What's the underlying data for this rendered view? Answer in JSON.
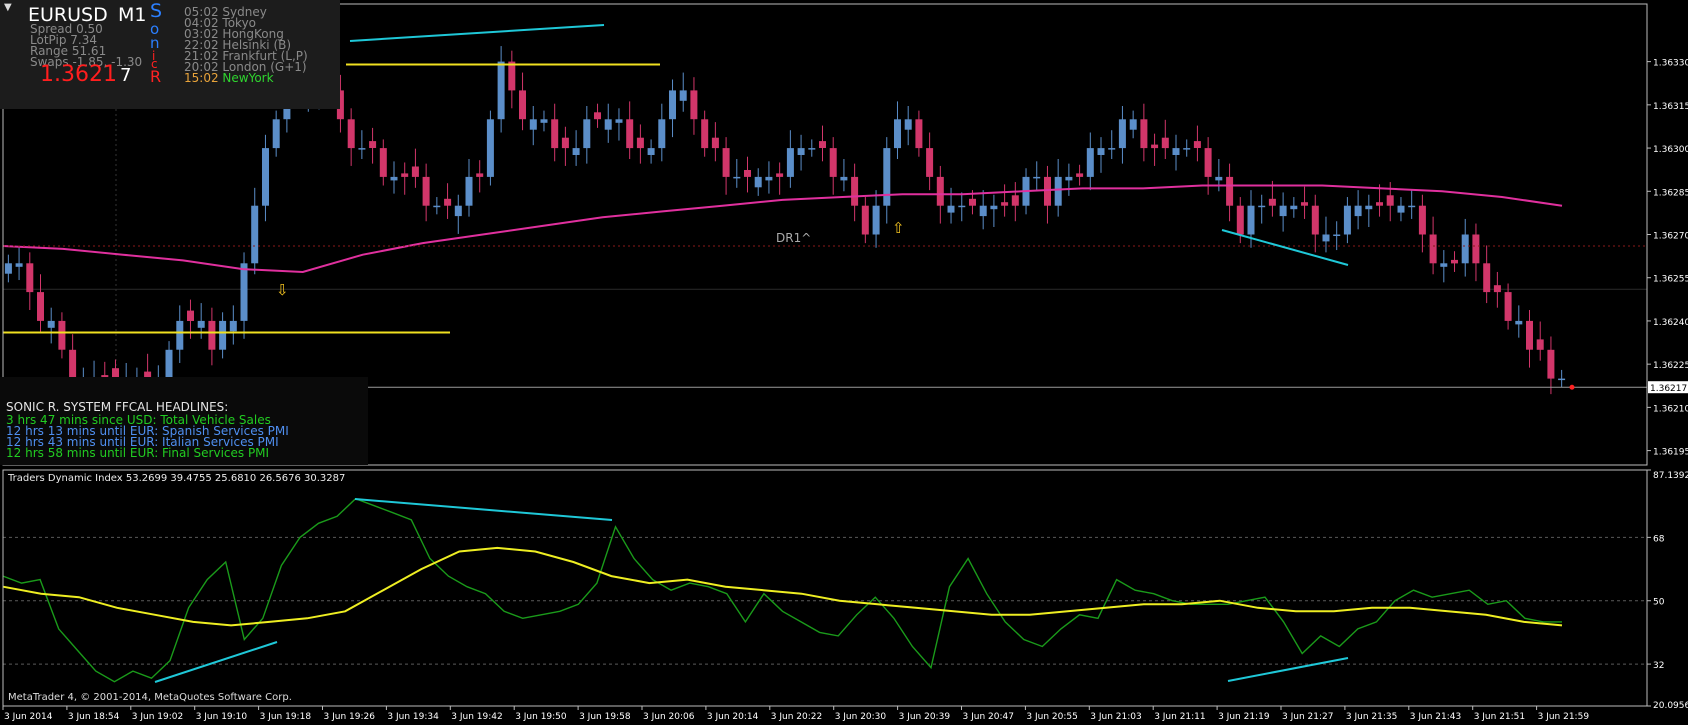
{
  "info": {
    "menu_glyph": "▼",
    "symbol": "EURUSD",
    "timeframe": "M1",
    "spread": "Spread 0.50",
    "lotpip": "LotPip 7.34",
    "range": "Range 51.61",
    "swaps": "Swaps -1.85, -1.30",
    "bid": "1.3621",
    "bid_digit": "7",
    "sonic_letters": [
      "S",
      "o",
      "n",
      "i",
      "c",
      "R"
    ]
  },
  "sessions": [
    {
      "time": "05:02",
      "city": "Sydney"
    },
    {
      "time": "04:02",
      "city": "Tokyo"
    },
    {
      "time": "03:02",
      "city": "HongKong"
    },
    {
      "time": "22:02",
      "city": "Helsinki (B)"
    },
    {
      "time": "21:02",
      "city": "Frankfurt (L,P)"
    },
    {
      "time": "20:02",
      "city": "London (G+1)"
    },
    {
      "time": "15:02",
      "city": "NewYork",
      "active": true
    }
  ],
  "headlines": {
    "title": "SONIC R. SYSTEM  FFCAL HEADLINES:",
    "items": [
      {
        "text": "3 hrs 47 mins since USD: Total Vehicle Sales",
        "color": "#22cc22"
      },
      {
        "text": "12 hrs 13 mins until EUR: Spanish Services PMI",
        "color": "#4f8ff0"
      },
      {
        "text": "12 hrs 43 mins until EUR: Italian Services PMI",
        "color": "#4f8ff0"
      },
      {
        "text": "12 hrs 58 mins until EUR: Final Services PMI",
        "color": "#22cc22"
      }
    ]
  },
  "annotation_dr1": "DR1^",
  "tdi_label": "Traders Dynamic Index 53.2699 39.4755 25.6810 26.5676 30.3287",
  "copyright": "MetaTrader 4, © 2001-2014, MetaQuotes Software Corp.",
  "colors": {
    "background": "#000000",
    "bull_candle": "#5b8ec9",
    "bear_candle": "#d2366a",
    "moving_average": "#e0309e",
    "trendline": "#1fc8d8",
    "horizontal_level": "#f0e020",
    "tdi_rsi": "#1a9a1a",
    "tdi_signal": "#eeee22",
    "axis_text": "#ffffff"
  },
  "chart_data": [
    {
      "type": "candlestick",
      "symbol": "EURUSD",
      "timeframe": "M1",
      "y_ticks": [
        "1.36330",
        "1.36315",
        "1.36300",
        "1.36285",
        "1.36270",
        "1.36255",
        "1.36240",
        "1.36225",
        "1.36210",
        "1.36195"
      ],
      "ylim": [
        1.3619,
        1.3635
      ],
      "current_price": "1.36217",
      "x_ticks": [
        "3 Jun 2014",
        "3 Jun 18:54",
        "3 Jun 19:02",
        "3 Jun 19:10",
        "3 Jun 19:18",
        "3 Jun 19:26",
        "3 Jun 19:34",
        "3 Jun 19:42",
        "3 Jun 19:50",
        "3 Jun 19:58",
        "3 Jun 20:06",
        "3 Jun 20:14",
        "3 Jun 20:22",
        "3 Jun 20:30",
        "3 Jun 20:39",
        "3 Jun 20:47",
        "3 Jun 20:55",
        "3 Jun 21:03",
        "3 Jun 21:11",
        "3 Jun 21:19",
        "3 Jun 21:27",
        "3 Jun 21:35",
        "3 Jun 21:43",
        "3 Jun 21:51",
        "3 Jun 21:59"
      ],
      "close_path": [
        1.3626,
        1.3626,
        1.3625,
        1.3624,
        1.3624,
        1.3623,
        1.3622,
        1.3622,
        1.3622,
        1.3622,
        1.3622,
        1.3622,
        1.3622,
        1.3622,
        1.3622,
        1.3623,
        1.3624,
        1.3624,
        1.3624,
        1.3623,
        1.3624,
        1.3624,
        1.3626,
        1.3628,
        1.363,
        1.3631,
        1.3632,
        1.3632,
        1.3632,
        1.3632,
        1.3632,
        1.3631,
        1.363,
        1.363,
        1.363,
        1.3629,
        1.3629,
        1.3629,
        1.3629,
        1.3628,
        1.3628,
        1.3628,
        1.3628,
        1.3629,
        1.3629,
        1.3631,
        1.3633,
        1.3632,
        1.3631,
        1.3631,
        1.3631,
        1.363,
        1.363,
        1.363,
        1.3631,
        1.3631,
        1.3631,
        1.3631,
        1.363,
        1.363,
        1.363,
        1.3631,
        1.3632,
        1.3632,
        1.3631,
        1.363,
        1.363,
        1.3629,
        1.3629,
        1.3629,
        1.3629,
        1.3629,
        1.3629,
        1.363,
        1.363,
        1.363,
        1.363,
        1.3629,
        1.3629,
        1.3628,
        1.3627,
        1.3628,
        1.363,
        1.3631,
        1.3631,
        1.363,
        1.3629,
        1.3628,
        1.3628,
        1.3628,
        1.3628,
        1.3628,
        1.3628,
        1.3628,
        1.3628,
        1.3629,
        1.3629,
        1.3628,
        1.3629,
        1.3629,
        1.3629,
        1.363,
        1.363,
        1.363,
        1.3631,
        1.3631,
        1.363,
        1.363,
        1.363,
        1.363,
        1.363,
        1.363,
        1.3629,
        1.3629,
        1.3628,
        1.3627,
        1.3628,
        1.3628,
        1.3628,
        1.3628,
        1.3628,
        1.3628,
        1.3627,
        1.3627,
        1.3627,
        1.3628,
        1.3628,
        1.3628,
        1.3628,
        1.3628,
        1.3628,
        1.3628,
        1.3627,
        1.3626,
        1.3626,
        1.3626,
        1.3627,
        1.3626,
        1.3625,
        1.3625,
        1.3624,
        1.3624,
        1.3623,
        1.3623,
        1.3622,
        1.3622
      ],
      "moving_average": [
        1.36266,
        1.36265,
        1.36263,
        1.36261,
        1.36258,
        1.36257,
        1.36263,
        1.36267,
        1.3627,
        1.36273,
        1.36276,
        1.36278,
        1.3628,
        1.36282,
        1.36283,
        1.36284,
        1.36284,
        1.36285,
        1.36286,
        1.36286,
        1.36287,
        1.36287,
        1.36287,
        1.36286,
        1.36285,
        1.36283,
        1.3628
      ],
      "horizontal_levels": [
        1.36236,
        1.36329
      ],
      "dotted_level": 1.36266
    },
    {
      "type": "line",
      "title": "Traders Dynamic Index",
      "y_ticks": [
        "87.1392",
        "68",
        "50",
        "32",
        "20.0956"
      ],
      "ylim": [
        20.0956,
        87.1392
      ],
      "series": [
        {
          "values": [
            57,
            55,
            56,
            42,
            36,
            30,
            27,
            30,
            28,
            33,
            48,
            56,
            61,
            39,
            45,
            60,
            68,
            72,
            74,
            79,
            77,
            75,
            73,
            62,
            57,
            54,
            52,
            47,
            45,
            46,
            47,
            49,
            55,
            71,
            62,
            56,
            53,
            55,
            54,
            52,
            44,
            52,
            47,
            44,
            41,
            40,
            46,
            51,
            45,
            37,
            31,
            54,
            62,
            52,
            44,
            39,
            37,
            42,
            46,
            45,
            56,
            53,
            52,
            50,
            49,
            49,
            49,
            50,
            51,
            44,
            35,
            40,
            37,
            42,
            44,
            50,
            53,
            51,
            52,
            53,
            49,
            50,
            45,
            44,
            44
          ]
        },
        {
          "values": [
            54,
            52,
            51,
            48,
            46,
            44,
            43,
            44,
            45,
            47,
            53,
            59,
            64,
            65,
            64,
            61,
            57,
            55,
            56,
            54,
            53,
            52,
            50,
            49,
            48,
            47,
            46,
            46,
            47,
            48,
            49,
            49,
            50,
            48,
            47,
            47,
            48,
            48,
            47,
            46,
            44,
            43
          ]
        }
      ]
    }
  ]
}
